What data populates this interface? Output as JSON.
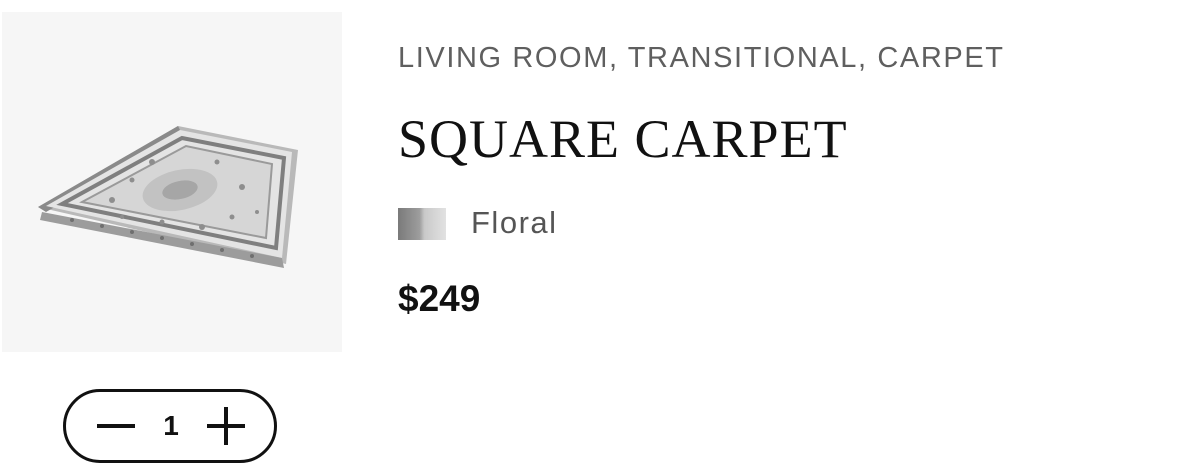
{
  "product": {
    "image_alt": "Square carpet floral rug",
    "categories": "LIVING ROOM, TRANSITIONAL, CARPET",
    "title": "SQUARE CARPET",
    "variant": {
      "label": "Floral",
      "swatch_colors": [
        "#7a7a7a",
        "#e2e2e2"
      ]
    },
    "price": "$249"
  },
  "quantity": {
    "value": "1",
    "decrement_icon": "minus-icon",
    "increment_icon": "plus-icon"
  }
}
